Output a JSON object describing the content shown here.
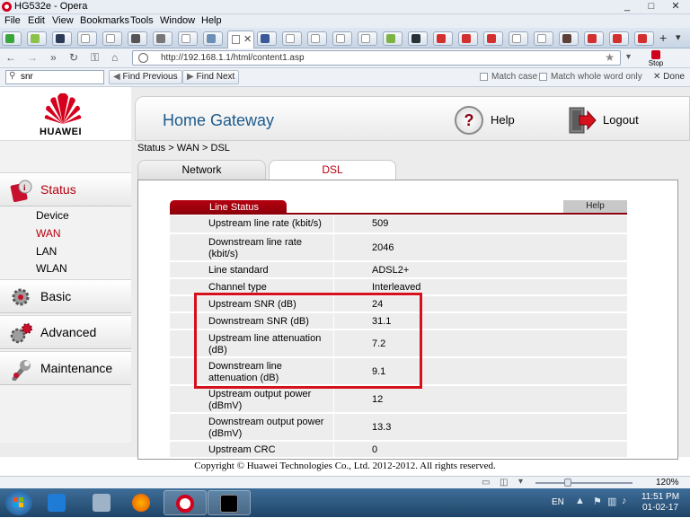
{
  "window": {
    "title": "HG532e - Opera",
    "controls": [
      "_",
      "□",
      "✕"
    ]
  },
  "menubar": [
    "File",
    "Edit",
    "View",
    "Bookmarks",
    "Tools",
    "Window",
    "Help"
  ],
  "address": {
    "url": "http://192.168.1.1/html/content1.asp",
    "stop_label": "Stop"
  },
  "findbar": {
    "query": "snr",
    "find_previous": "Find Previous",
    "find_next": "Find Next",
    "match_case": "Match case",
    "match_whole_word": "Match whole word only",
    "done": "Done"
  },
  "router": {
    "brand": "HUAWEI",
    "header_title": "Home Gateway",
    "help_label": "Help",
    "logout_label": "Logout",
    "breadcrumb": "Status > WAN > DSL",
    "tabs": [
      "Network",
      "DSL"
    ],
    "active_tab": "DSL",
    "sidebar": {
      "status": "Status",
      "status_sub": [
        "Device",
        "WAN",
        "LAN",
        "WLAN"
      ],
      "active_sub": "WAN",
      "basic": "Basic",
      "advanced": "Advanced",
      "maintenance": "Maintenance"
    },
    "line_status": {
      "title": "Line Status",
      "help": "Help",
      "rows": [
        {
          "label": "Upstream line rate (kbit/s)",
          "value": "509"
        },
        {
          "label": "Downstream line rate (kbit/s)",
          "value": "2046"
        },
        {
          "label": "Line standard",
          "value": "ADSL2+"
        },
        {
          "label": "Channel type",
          "value": "Interleaved"
        },
        {
          "label": "Upstream SNR (dB)",
          "value": "24"
        },
        {
          "label": "Downstream SNR (dB)",
          "value": "31.1"
        },
        {
          "label": "Upstream line attenuation (dB)",
          "value": "7.2"
        },
        {
          "label": "Downstream line attenuation (dB)",
          "value": "9.1"
        },
        {
          "label": "Upstream output power (dBmV)",
          "value": "12"
        },
        {
          "label": "Downstream output power (dBmV)",
          "value": "13.3"
        },
        {
          "label": "Upstream CRC",
          "value": "0"
        }
      ]
    },
    "footer": "Copyright © Huawei Technologies Co., Ltd. 2012-2012. All rights reserved."
  },
  "statusbar": {
    "zoom": "120%",
    "zoom_fraction": 0.33
  },
  "taskbar": {
    "lang": "EN",
    "time": "11:51 PM",
    "date": "01-02-17"
  }
}
